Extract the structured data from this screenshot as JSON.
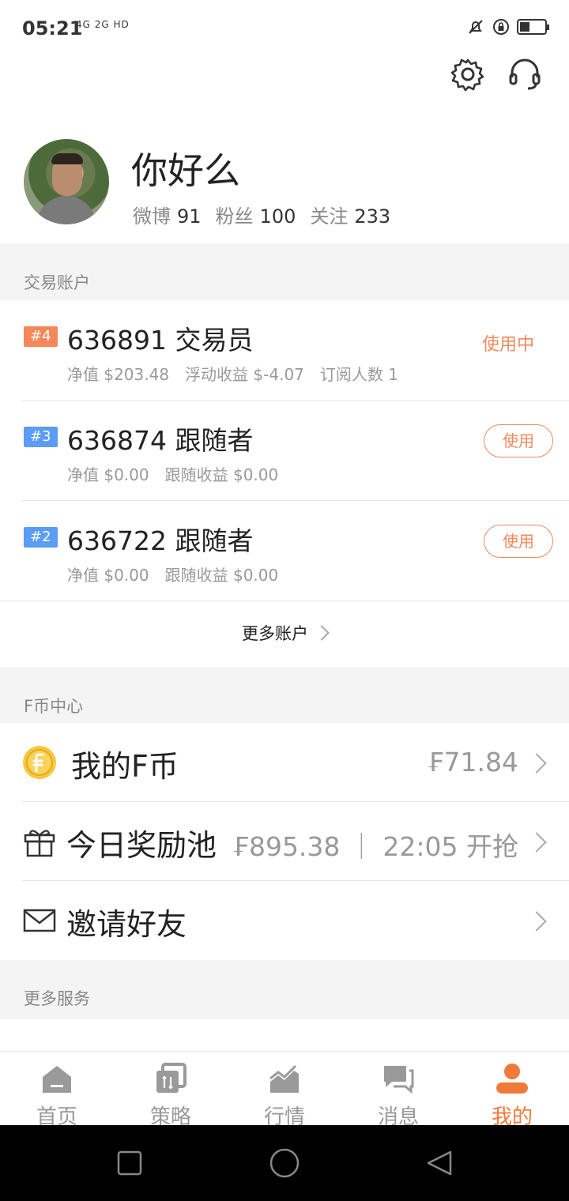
{
  "status": {
    "time": "05:21",
    "network": "4G 2G HD"
  },
  "profile": {
    "name": "你好么",
    "weibo_label": "微博",
    "weibo_count": "91",
    "fans_label": "粉丝",
    "fans_count": "100",
    "follow_label": "关注",
    "follow_count": "233"
  },
  "sections": {
    "accounts": "交易账户",
    "fcoin": "F币中心",
    "more_services": "更多服务"
  },
  "accounts": [
    {
      "tag": "#4",
      "tag_color": "#f5875b",
      "title": "636891 交易员",
      "sub": [
        "净值 $203.48",
        "浮动收益 $-4.07",
        "订阅人数 1"
      ],
      "status": "使用中"
    },
    {
      "tag": "#3",
      "tag_color": "#5b9cf5",
      "title": "636874 跟随者",
      "sub": [
        "净值 $0.00",
        "跟随收益 $0.00"
      ],
      "button": "使用"
    },
    {
      "tag": "#2",
      "tag_color": "#5b9cf5",
      "title": "636722 跟随者",
      "sub": [
        "净值 $0.00",
        "跟随收益 $0.00"
      ],
      "button": "使用"
    }
  ],
  "more_accounts": "更多账户",
  "fcoin": {
    "my_coin_label": "我的F币",
    "my_coin_value": "₣71.84",
    "reward_label": "今日奖励池",
    "reward_value": "₣895.38 ｜ 22:05 开抢",
    "invite_label": "邀请好友"
  },
  "tabs": [
    {
      "label": "首页",
      "icon": "home-icon"
    },
    {
      "label": "策略",
      "icon": "strategy-icon"
    },
    {
      "label": "行情",
      "icon": "market-icon"
    },
    {
      "label": "消息",
      "icon": "message-icon"
    },
    {
      "label": "我的",
      "icon": "profile-icon",
      "active": true
    }
  ],
  "colors": {
    "accent": "#f07a3a",
    "tag_orange": "#f5875b",
    "tag_blue": "#5b9cf5"
  }
}
